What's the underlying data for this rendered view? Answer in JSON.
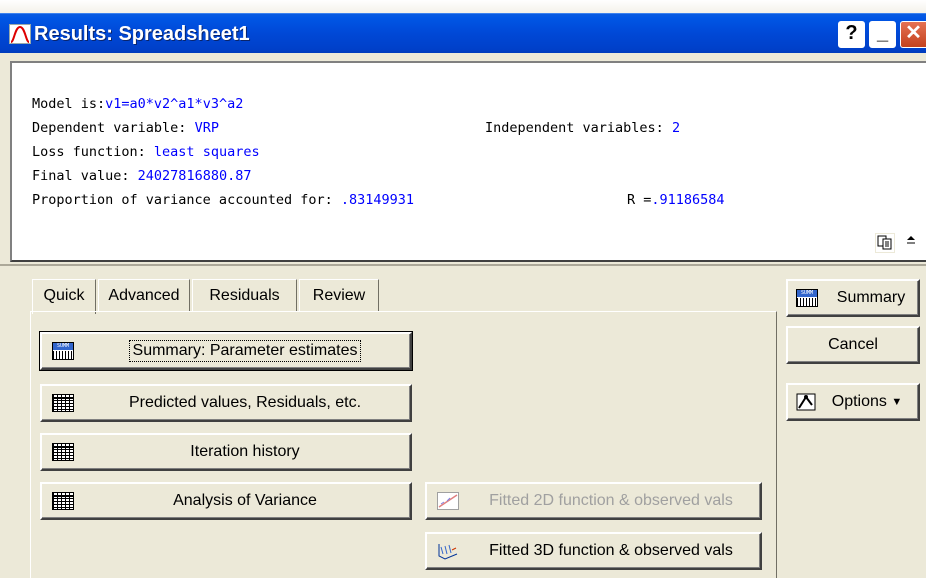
{
  "window": {
    "title": "Results: Spreadsheet1",
    "buttons": {
      "help": "?",
      "minimize": "_",
      "close": "✕"
    }
  },
  "output": {
    "model_label": "Model is:",
    "model_value": "v1=a0*v2^a1*v3^a2",
    "dependent_label": "Dependent variable: ",
    "dependent_value": "VRP",
    "independent_label": "Independent variables: ",
    "independent_value": "2",
    "loss_label": "Loss function: ",
    "loss_value": "least squares",
    "final_label": "Final value: ",
    "final_value": "24027816880.87",
    "proportion_label": "Proportion of variance accounted for: ",
    "proportion_value": ".83149931",
    "r_label": "R =",
    "r_value": ".91186584"
  },
  "tabs": [
    {
      "label": "Quick",
      "active": true
    },
    {
      "label": "Advanced"
    },
    {
      "label": "Residuals"
    },
    {
      "label": "Review"
    }
  ],
  "quick": {
    "summary_btn": "Summary: Parameter estimates",
    "predicted_btn": "Predicted values, Residuals, etc.",
    "iteration_btn": "Iteration history",
    "anova_btn": "Analysis of Variance",
    "fitted2d_btn": "Fitted 2D function & observed vals",
    "fitted3d_btn": "Fitted 3D function & observed vals"
  },
  "side": {
    "summary": "Summary",
    "cancel": "Cancel",
    "options": "Options",
    "options_arrow": "▼"
  },
  "icons": {
    "app": "graph-icon",
    "summary": "summary-table-icon",
    "grid": "spreadsheet-grid-icon",
    "plot2d": "2d-plot-icon",
    "plot3d": "3d-plot-icon",
    "options": "options-icon",
    "copy": "copy-icon",
    "expand": "expand-icon"
  },
  "colors": {
    "value_text": "#0000ff",
    "titlebar": "#0048d6"
  }
}
